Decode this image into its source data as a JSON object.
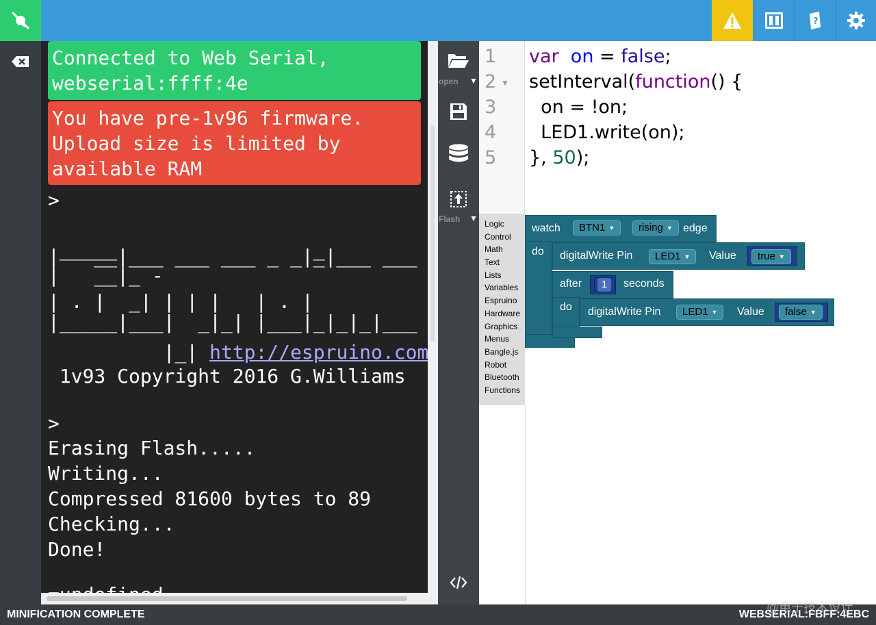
{
  "topbar": {
    "connect_icon": "plug-icon",
    "warning_icon": "warning-icon",
    "layout_icon": "split-view-icon",
    "help_icon": "help-book-icon",
    "settings_icon": "gear-icon",
    "colors": {
      "bar": "#3a9ad9",
      "connected": "#2ecc71",
      "warning": "#f1c40f"
    }
  },
  "leftbar": {
    "clear_icon": "clear-terminal-icon"
  },
  "terminal": {
    "connected_message": "Connected to Web Serial,\nwebserial:ffff:4e",
    "firmware_message": "You have pre-1v96 firmware.\nUpload size is limited by\navailable RAM",
    "prompt1": ">",
    "banner": [
      " _____                 _",
      "|   __|___ ___ ___ _ _|_|___ ___",
      "|   __|_ -",
      "| . |  _| | | |   | . |",
      "|_____|___|  _|_| |___|_|_|_|___"
    ],
    "banner_link_prefix": "          |_| ",
    "banner_link": "http://espruino.com",
    "copyright": " 1v93 Copyright 2016 G.Williams",
    "prompt2": ">",
    "output": [
      "Erasing Flash.....",
      "Writing...",
      "Compressed 81600 bytes to 89",
      "Checking...",
      "Done!"
    ],
    "last_partial": "=undefined"
  },
  "midbar": {
    "open_icon": "folder-open-icon",
    "open_label": "open",
    "save_icon": "save-icon",
    "storage_icon": "database-icon",
    "flash_icon": "flash-upload-icon",
    "flash_label": "Flash",
    "code_toggle_icon": "code-icon"
  },
  "editor": {
    "line_numbers": [
      "1",
      "2",
      "3",
      "4",
      "5"
    ],
    "lines": [
      {
        "tokens": [
          {
            "t": "var",
            "c": "kw"
          },
          {
            "t": "  "
          },
          {
            "t": "on",
            "c": "var"
          },
          {
            "t": " = "
          },
          {
            "t": "false",
            "c": "atom"
          },
          {
            "t": ";"
          }
        ]
      },
      {
        "tokens": [
          {
            "t": "setInterval("
          },
          {
            "t": "function",
            "c": "kw"
          },
          {
            "t": "() {"
          }
        ]
      },
      {
        "tokens": [
          {
            "t": "  on = !on;"
          }
        ]
      },
      {
        "tokens": [
          {
            "t": "  LED1.write(on);"
          }
        ]
      },
      {
        "tokens": [
          {
            "t": "}, "
          },
          {
            "t": "50",
            "c": "num"
          },
          {
            "t": ");"
          }
        ]
      }
    ]
  },
  "blockly": {
    "categories": [
      "Logic",
      "Control",
      "Math",
      "Text",
      "Lists",
      "Variables",
      "Espruino",
      "Hardware",
      "Graphics",
      "Menus",
      "Bangle.js",
      "Robot",
      "Bluetooth",
      "Functions"
    ],
    "watch_label": "watch",
    "watch_pin": "BTN1",
    "watch_edge": "rising",
    "edge_label": "edge",
    "do_label": "do",
    "dw1_label": "digitalWrite Pin",
    "dw1_pin": "LED1",
    "value_label": "Value",
    "dw1_value": "true",
    "after_label": "after",
    "after_num": "1",
    "seconds_label": "seconds",
    "do2_label": "do",
    "dw2_label": "digitalWrite Pin",
    "dw2_pin": "LED1",
    "value2_label": "Value",
    "dw2_value": "false"
  },
  "statusbar": {
    "left": "MINIFICATION COMPLETE",
    "right": "WEBSERIAL:FBFF:4EBC"
  },
  "watermark": "@电子技术设计"
}
